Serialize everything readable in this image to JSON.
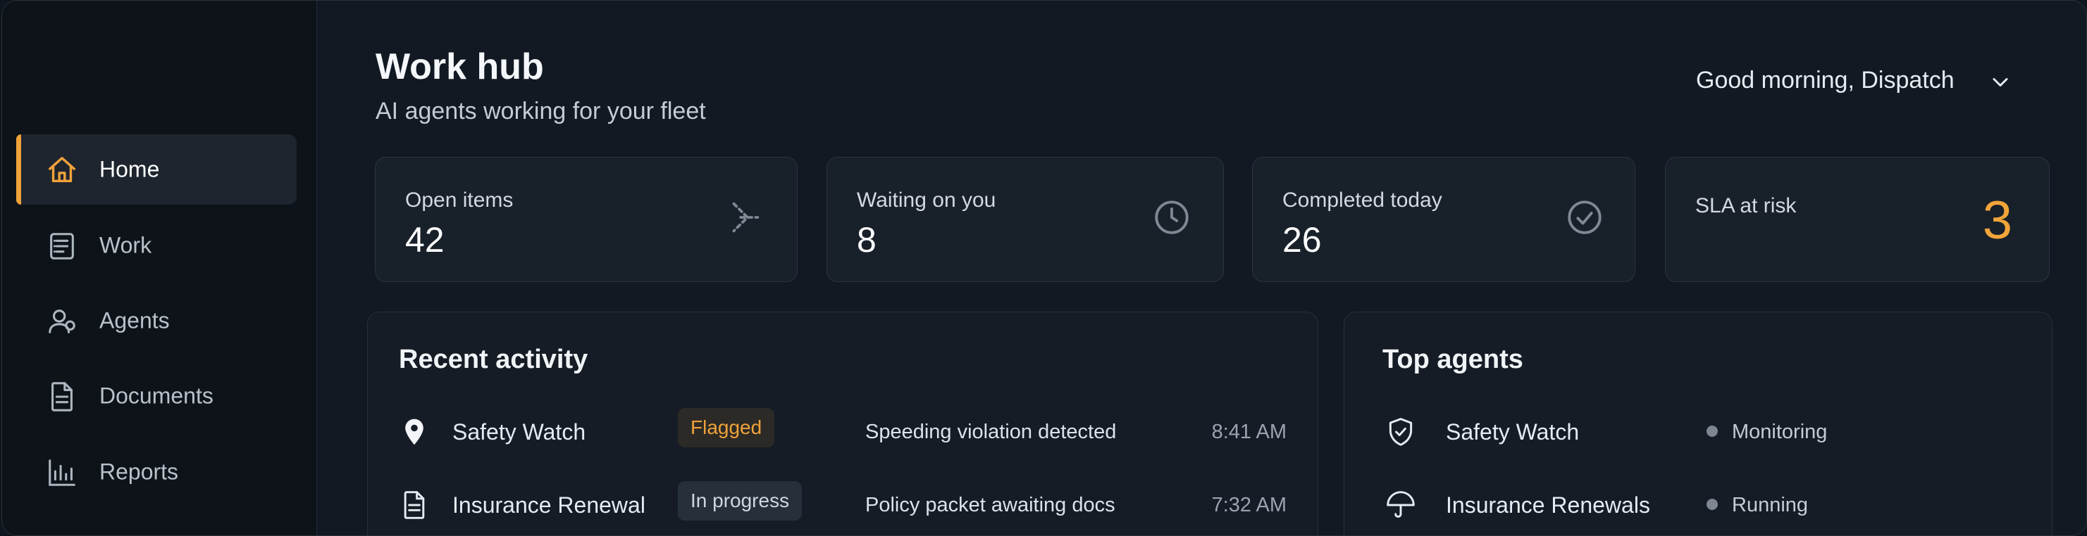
{
  "sidebar": {
    "items": [
      {
        "label": "Home",
        "icon": "home-icon",
        "active": true
      },
      {
        "label": "Work",
        "icon": "work-list-icon",
        "active": false
      },
      {
        "label": "Agents",
        "icon": "agents-icon",
        "active": false
      },
      {
        "label": "Documents",
        "icon": "document-icon",
        "active": false
      },
      {
        "label": "Reports",
        "icon": "bar-chart-icon",
        "active": false
      }
    ]
  },
  "header": {
    "title": "Work hub",
    "subtitle": "AI agents working for your fleet",
    "greeting": "Good morning, Dispatch"
  },
  "stats": [
    {
      "label": "Open items",
      "value": "42",
      "icon": "dashed-arrow-icon"
    },
    {
      "label": "Waiting on you",
      "value": "8",
      "icon": "clock-icon"
    },
    {
      "label": "Completed today",
      "value": "26",
      "icon": "check-circle-icon"
    },
    {
      "label": "SLA at risk",
      "value": "3",
      "icon": ""
    }
  ],
  "recent_activity": {
    "title": "Recent activity",
    "rows": [
      {
        "name": "Safety Watch",
        "icon": "location-pin-icon",
        "status": "Flagged",
        "description": "Speeding violation detected",
        "time": "8:41 AM"
      },
      {
        "name": "Insurance Renewal",
        "icon": "document-icon",
        "status": "In progress",
        "description": "Policy packet awaiting docs",
        "time": "7:32 AM"
      }
    ]
  },
  "top_agents": {
    "title": "Top agents",
    "rows": [
      {
        "name": "Safety Watch",
        "icon": "shield-check-icon",
        "status": "Monitoring"
      },
      {
        "name": "Insurance Renewals",
        "icon": "umbrella-icon",
        "status": "Running"
      }
    ]
  },
  "colors": {
    "accent": "#f0a23a",
    "background": "#121922",
    "sidebar": "#0d1319",
    "card": "#18202a"
  }
}
